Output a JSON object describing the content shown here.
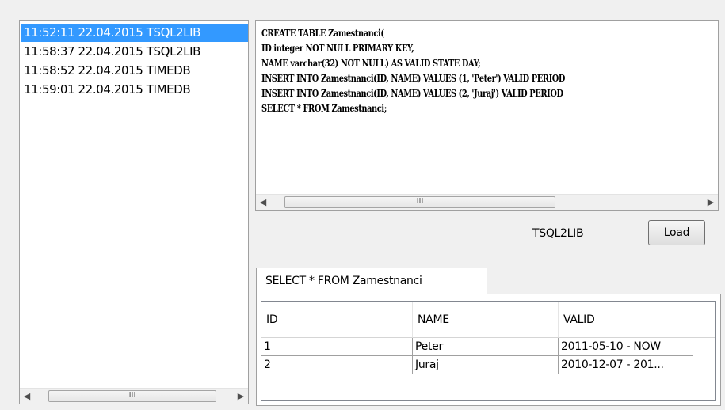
{
  "history": {
    "items": [
      {
        "label": "11:52:11 22.04.2015 TSQL2LIB",
        "selected": true
      },
      {
        "label": "11:58:37 22.04.2015 TSQL2LIB",
        "selected": false
      },
      {
        "label": "11:58:52 22.04.2015 TIMEDB",
        "selected": false
      },
      {
        "label": "11:59:01 22.04.2015 TIMEDB",
        "selected": false
      }
    ]
  },
  "editor": {
    "lines": [
      "CREATE TABLE Zamestnanci(",
      "ID integer NOT NULL PRIMARY KEY,",
      "NAME varchar(32) NOT NULL) AS VALID STATE DAY;",
      "INSERT INTO Zamestnanci(ID, NAME) VALUES (1, 'Peter') VALID PERIOD",
      "INSERT INTO Zamestnanci(ID, NAME) VALUES (2, 'Juraj') VALID PERIOD",
      "SELECT * FROM Zamestnanci;"
    ]
  },
  "scrollbar": {
    "grip": "III",
    "left_icon": "left-arrow-icon",
    "right_icon": "right-arrow-icon"
  },
  "connection": {
    "label": "TSQL2LIB"
  },
  "load_button": {
    "label": "Load"
  },
  "result_tab": {
    "label": "SELECT * FROM Zamestnanci"
  },
  "result_table": {
    "columns": [
      "ID",
      "NAME",
      "VALID"
    ],
    "rows": [
      [
        "1",
        "Peter",
        "2011-05-10 - NOW"
      ],
      [
        "2",
        "Juraj",
        "2010-12-07 - 201..."
      ]
    ]
  },
  "colors": {
    "selection": "#3399ff",
    "background": "#f0f0f0"
  }
}
